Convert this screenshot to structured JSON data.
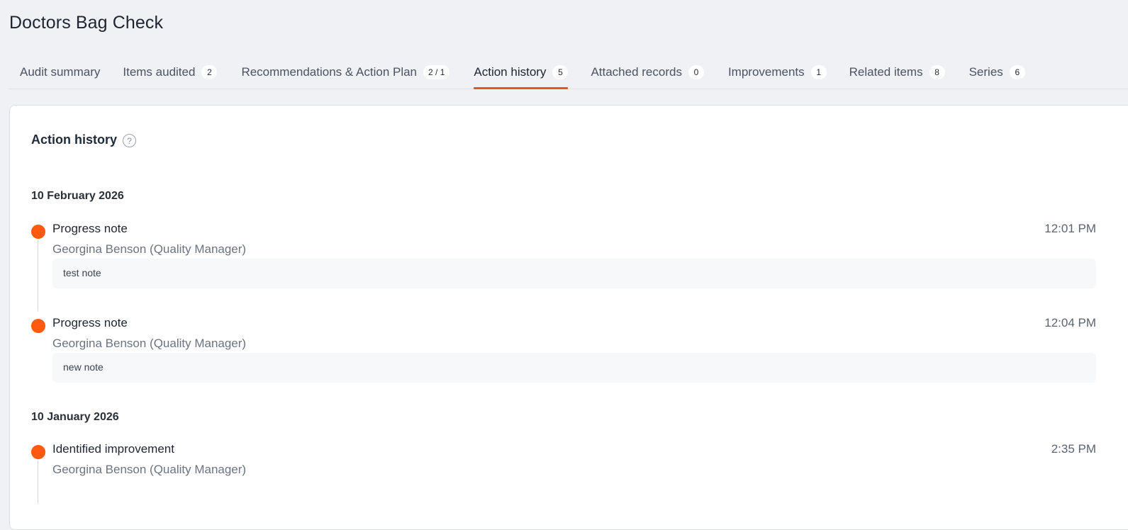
{
  "page": {
    "title": "Doctors Bag Check"
  },
  "tabs": [
    {
      "label": "Audit summary",
      "badge": ""
    },
    {
      "label": "Items audited",
      "badge": "2"
    },
    {
      "label": "Recommendations & Action Plan",
      "badge": "2 / 1"
    },
    {
      "label": "Action history",
      "badge": "5"
    },
    {
      "label": "Attached records",
      "badge": "0"
    },
    {
      "label": "Improvements",
      "badge": "1"
    },
    {
      "label": "Related items",
      "badge": "8"
    },
    {
      "label": "Series",
      "badge": "6"
    }
  ],
  "active_tab": "Action history",
  "panel": {
    "title": "Action history",
    "help_icon_glyph": "?",
    "groups": [
      {
        "date": "10 February 2026",
        "entries": [
          {
            "title": "Progress note",
            "time": "12:01 PM",
            "author": "Georgina Benson (Quality Manager)",
            "note": "test note"
          },
          {
            "title": "Progress note",
            "time": "12:04 PM",
            "author": "Georgina Benson (Quality Manager)",
            "note": "new note"
          }
        ]
      },
      {
        "date": "10 January 2026",
        "entries": [
          {
            "title": "Identified improvement",
            "time": "2:35 PM",
            "author": "Georgina Benson (Quality Manager)",
            "note": ""
          }
        ]
      }
    ]
  },
  "colors": {
    "accent": "#e3561e",
    "timeline_dot": "#ff5a0f",
    "background": "#f0f1f4",
    "panel": "#ffffff"
  },
  "icons": {
    "help": "question-circle-icon",
    "timeline_marker": "dot-icon"
  }
}
